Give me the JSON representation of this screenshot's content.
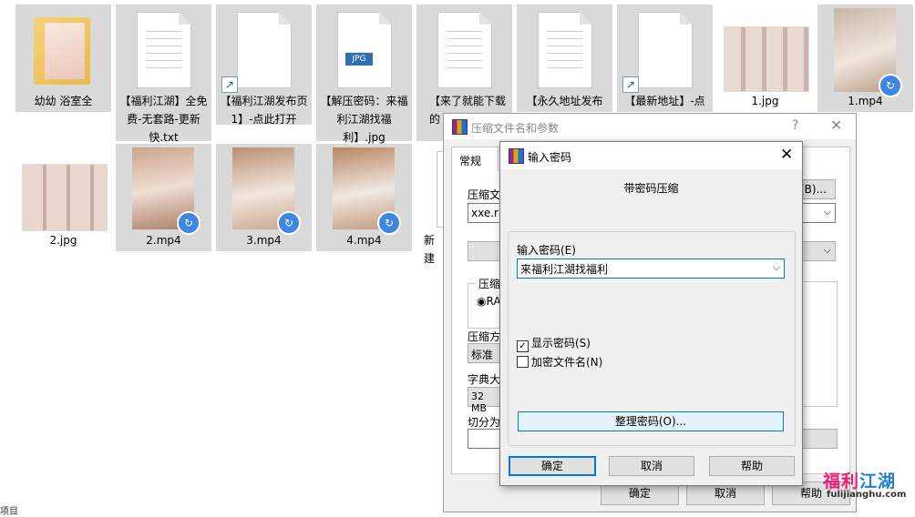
{
  "files": [
    {
      "name": "幼幼 浴室全",
      "kind": "folder"
    },
    {
      "name": "【福利江湖】全免费-无套路-更新快.txt",
      "kind": "txt"
    },
    {
      "name": "【福利江湖发布页1】-点此打开",
      "kind": "shortcut"
    },
    {
      "name": "【解压密码：来福利江湖找福利】.jpg",
      "kind": "jpg",
      "badge": "JPG"
    },
    {
      "name": "【来了就能下载的",
      "kind": "txt"
    },
    {
      "name": "【永久地址发布",
      "kind": "txt"
    },
    {
      "name": "【最新地址】-点",
      "kind": "shortcut"
    },
    {
      "name": "1.jpg",
      "kind": "image"
    },
    {
      "name": "1.mp4",
      "kind": "video"
    },
    {
      "name": "2.jpg",
      "kind": "image"
    },
    {
      "name": "2.mp4",
      "kind": "video"
    },
    {
      "name": "3.mp4",
      "kind": "video"
    },
    {
      "name": "4.mp4",
      "kind": "video"
    },
    {
      "name": "新建",
      "kind": "partial"
    }
  ],
  "archive_dialog": {
    "title": "压缩文件名和参数",
    "help_glyph": "?",
    "close_glyph": "✕",
    "tab_general": "常规",
    "archive_name_label": "压缩文",
    "browse_button": "(B)...",
    "archive_name_value": "xxe.ra",
    "format_label": "压缩",
    "format_rar": "RA",
    "method_label": "压缩方",
    "method_value": "标准",
    "dict_label": "字典大",
    "dict_value": "32 MB",
    "split_label": "切分为",
    "ok": "确定",
    "cancel": "取消",
    "help": "帮助"
  },
  "password_dialog": {
    "title": "输入密码",
    "close_glyph": "✕",
    "heading": "带密码压缩",
    "password_label": "输入密码(E)",
    "password_value": "来福利江湖找福利",
    "show_password": "显示密码(S)",
    "show_password_checked": true,
    "encrypt_names": "加密文件名(N)",
    "encrypt_names_checked": false,
    "manage_button": "整理密码(O)...",
    "ok": "确定",
    "cancel": "取消",
    "help": "帮助"
  },
  "watermark": {
    "cn_a": "福利",
    "cn_b": "江湖",
    "url": "fulijianghu.com"
  },
  "status_fragment": "项目"
}
